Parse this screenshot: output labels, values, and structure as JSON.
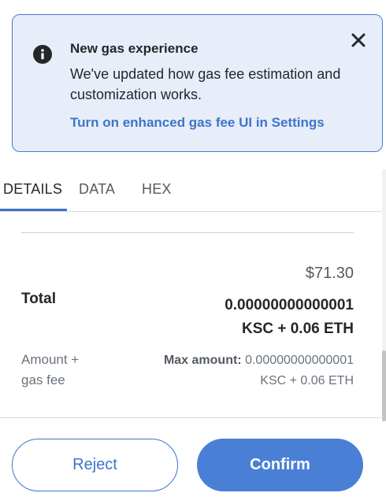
{
  "banner": {
    "title": "New gas experience",
    "body": "We've updated how gas fee estimation and customization works.",
    "link": "Turn on enhanced gas fee UI in Settings",
    "icon": "info-icon",
    "close_icon": "close-icon"
  },
  "tabs": [
    {
      "label": "DETAILS",
      "active": true
    },
    {
      "label": "DATA",
      "active": false
    },
    {
      "label": "HEX",
      "active": false
    }
  ],
  "details": {
    "fiat_total": "$71.30",
    "total_label": "Total",
    "total_line1": "0.00000000000001",
    "total_line2": "KSC + 0.06 ETH",
    "sub_label_line1": "Amount +",
    "sub_label_line2": "gas fee",
    "max_label": "Max amount:",
    "max_value_line1": "0.00000000000001",
    "max_value_line2": "KSC + 0.06 ETH"
  },
  "actions": {
    "reject": "Reject",
    "confirm": "Confirm"
  },
  "colors": {
    "accent": "#3e74c9",
    "banner_bg": "#e7eef9",
    "confirm_bg": "#4a7fd6"
  }
}
